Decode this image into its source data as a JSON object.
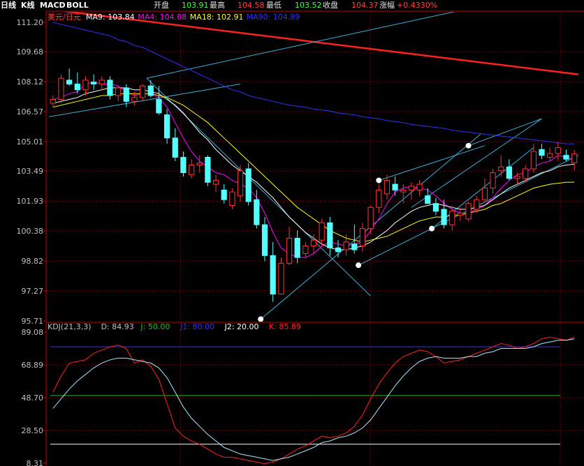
{
  "header": {
    "tabs": [
      {
        "label": "日线",
        "color": "#ffffff"
      },
      {
        "label": "K线",
        "color": "#ffffff"
      },
      {
        "label": "MACD",
        "color": "#ffffff"
      },
      {
        "label": "BOLL",
        "color": "#ffffff"
      }
    ],
    "quote": [
      {
        "label": "开盘",
        "value": "103.91"
      },
      {
        "label": "最高",
        "value": "104.58"
      },
      {
        "label": "最低",
        "value": "103.52"
      },
      {
        "label": "收盘",
        "value": "104.37"
      },
      {
        "label": "涨幅",
        "value": "+0.4330%"
      }
    ]
  },
  "chart_data": [
    {
      "type": "candlestick",
      "symbol": "美元/日元",
      "legend": [
        {
          "text": "MA9: 103.84",
          "color": "#ffffff"
        },
        {
          "text": "MA4: 104.08",
          "color": "#ff00ff"
        },
        {
          "text": "MA18: 102.91",
          "color": "#ffff00"
        },
        {
          "text": "MA90: 104.89",
          "color": "#3030ff"
        }
      ],
      "y_ticks": [
        "111.20",
        "109.68",
        "108.12",
        "106.57",
        "105.01",
        "103.49",
        "101.93",
        "100.38",
        "98.82",
        "97.27",
        "95.71"
      ],
      "ylim": [
        95.71,
        111.2
      ],
      "candles": [
        [
          107.0,
          107.4,
          106.8,
          107.2
        ],
        [
          107.2,
          108.5,
          107.0,
          108.3
        ],
        [
          108.2,
          108.8,
          107.9,
          108.0
        ],
        [
          108.0,
          108.6,
          107.5,
          107.7
        ],
        [
          107.7,
          108.4,
          107.4,
          108.2
        ],
        [
          108.1,
          108.5,
          107.7,
          108.0
        ],
        [
          108.0,
          108.4,
          107.7,
          108.2
        ],
        [
          108.2,
          108.4,
          107.2,
          107.4
        ],
        [
          107.4,
          107.9,
          107.1,
          107.8
        ],
        [
          107.8,
          108.0,
          106.8,
          107.1
        ],
        [
          107.1,
          107.6,
          106.9,
          107.3
        ],
        [
          107.3,
          108.0,
          107.1,
          107.9
        ],
        [
          107.9,
          108.2,
          107.3,
          107.4
        ],
        [
          107.2,
          107.9,
          106.4,
          106.5
        ],
        [
          106.4,
          106.7,
          104.9,
          105.2
        ],
        [
          105.2,
          105.7,
          104.0,
          104.2
        ],
        [
          104.2,
          104.5,
          103.2,
          103.4
        ],
        [
          103.3,
          104.1,
          103.1,
          103.8
        ],
        [
          103.8,
          104.3,
          103.4,
          103.9
        ],
        [
          104.2,
          104.3,
          102.7,
          102.9
        ],
        [
          102.8,
          103.3,
          102.4,
          103.0
        ],
        [
          102.5,
          102.8,
          101.8,
          102.0
        ],
        [
          101.7,
          102.6,
          101.5,
          102.4
        ],
        [
          102.2,
          103.8,
          101.9,
          103.5
        ],
        [
          103.6,
          103.9,
          101.7,
          101.9
        ],
        [
          102.0,
          102.5,
          100.5,
          100.7
        ],
        [
          100.7,
          101.1,
          98.8,
          99.1
        ],
        [
          99.1,
          99.8,
          96.7,
          97.1
        ],
        [
          97.1,
          99.0,
          97.1,
          98.7
        ],
        [
          98.7,
          100.6,
          98.6,
          100.0
        ],
        [
          100.0,
          100.4,
          98.7,
          99.0
        ],
        [
          99.2,
          99.8,
          99.0,
          99.6
        ],
        [
          99.6,
          100.2,
          99.2,
          99.9
        ],
        [
          99.9,
          101.0,
          99.6,
          100.8
        ],
        [
          100.8,
          101.1,
          99.1,
          99.5
        ],
        [
          99.5,
          99.9,
          99.0,
          99.3
        ],
        [
          99.4,
          100.2,
          99.1,
          99.8
        ],
        [
          99.7,
          100.7,
          99.2,
          99.4
        ],
        [
          99.6,
          100.8,
          99.3,
          100.5
        ],
        [
          100.5,
          101.7,
          100.2,
          101.6
        ],
        [
          101.6,
          102.8,
          101.3,
          102.5
        ],
        [
          102.3,
          103.3,
          102.0,
          103.0
        ],
        [
          102.8,
          103.2,
          102.2,
          102.5
        ],
        [
          102.4,
          102.8,
          101.8,
          102.5
        ],
        [
          102.5,
          102.9,
          102.0,
          102.7
        ],
        [
          102.5,
          103.0,
          102.2,
          102.8
        ],
        [
          102.2,
          102.6,
          101.8,
          101.8
        ],
        [
          101.8,
          102.1,
          101.2,
          101.4
        ],
        [
          101.5,
          102.0,
          100.5,
          100.7
        ],
        [
          100.7,
          101.7,
          100.4,
          101.4
        ],
        [
          101.2,
          101.6,
          100.9,
          101.3
        ],
        [
          101.0,
          101.9,
          100.9,
          101.8
        ],
        [
          101.5,
          102.2,
          101.3,
          102.0
        ],
        [
          102.0,
          103.1,
          101.9,
          102.6
        ],
        [
          102.6,
          103.6,
          102.3,
          103.4
        ],
        [
          103.5,
          104.3,
          103.2,
          103.7
        ],
        [
          103.7,
          104.1,
          103.0,
          103.1
        ],
        [
          103.1,
          103.4,
          102.8,
          103.2
        ],
        [
          103.1,
          103.8,
          102.9,
          103.6
        ],
        [
          103.6,
          104.9,
          103.4,
          104.5
        ],
        [
          104.6,
          104.9,
          104.1,
          104.3
        ],
        [
          104.2,
          104.7,
          104.0,
          104.4
        ],
        [
          104.4,
          105.0,
          104.0,
          104.7
        ],
        [
          104.3,
          104.6,
          104.0,
          104.1
        ],
        [
          103.91,
          104.58,
          103.52,
          104.37
        ]
      ],
      "ma": [
        {
          "name": "MA4",
          "color": "#ff00ff",
          "values": [
            107.2,
            107.3,
            107.5,
            107.6,
            108.0,
            108.1,
            108.0,
            108.0,
            107.9,
            107.6,
            107.4,
            107.5,
            107.5,
            107.3,
            106.8,
            106.0,
            105.2,
            104.5,
            104.0,
            103.7,
            103.4,
            103.3,
            103.0,
            102.8,
            102.6,
            102.1,
            101.3,
            100.3,
            99.5,
            99.2,
            99.0,
            99.0,
            99.2,
            99.6,
            99.8,
            99.7,
            99.6,
            99.7,
            99.8,
            100.4,
            101.0,
            101.8,
            102.4,
            102.6,
            102.7,
            102.6,
            102.5,
            102.2,
            101.8,
            101.5,
            101.3,
            101.3,
            101.5,
            101.7,
            102.1,
            102.6,
            103.0,
            103.3,
            103.4,
            103.7,
            103.9,
            104.0,
            104.3,
            104.2,
            104.08
          ]
        },
        {
          "name": "MA9",
          "color": "#ffffff",
          "values": [
            107.0,
            107.1,
            107.2,
            107.3,
            107.5,
            107.6,
            107.7,
            107.8,
            107.8,
            107.8,
            107.7,
            107.7,
            107.6,
            107.5,
            107.2,
            106.9,
            106.5,
            106.0,
            105.5,
            105.1,
            104.6,
            104.2,
            103.8,
            103.5,
            103.2,
            102.9,
            102.5,
            102.1,
            101.6,
            101.1,
            100.7,
            100.3,
            100.0,
            99.7,
            99.5,
            99.4,
            99.4,
            99.5,
            99.6,
            99.8,
            100.1,
            100.4,
            100.8,
            101.1,
            101.4,
            101.6,
            101.7,
            101.8,
            101.7,
            101.6,
            101.5,
            101.5,
            101.6,
            101.7,
            102.0,
            102.3,
            102.6,
            102.8,
            103.0,
            103.2,
            103.4,
            103.5,
            103.7,
            103.8,
            103.84
          ]
        },
        {
          "name": "MA18",
          "color": "#ffff00",
          "values": [
            106.8,
            106.9,
            107.0,
            107.1,
            107.2,
            107.3,
            107.4,
            107.4,
            107.5,
            107.5,
            107.5,
            107.5,
            107.5,
            107.4,
            107.3,
            107.1,
            106.9,
            106.6,
            106.3,
            106.0,
            105.6,
            105.2,
            104.8,
            104.4,
            104.0,
            103.6,
            103.2,
            102.8,
            102.4,
            102.0,
            101.6,
            101.3,
            101.0,
            100.7,
            100.4,
            100.2,
            100.0,
            99.9,
            99.8,
            99.9,
            100.0,
            100.1,
            100.3,
            100.5,
            100.7,
            100.9,
            101.0,
            101.1,
            101.1,
            101.2,
            101.2,
            101.3,
            101.4,
            101.5,
            101.7,
            101.8,
            102.0,
            102.2,
            102.4,
            102.6,
            102.7,
            102.8,
            102.85,
            102.9,
            102.91
          ]
        },
        {
          "name": "MA90",
          "color": "#3030ff",
          "values": [
            111.2,
            111.1,
            111.0,
            110.9,
            110.8,
            110.7,
            110.6,
            110.5,
            110.3,
            110.2,
            110.0,
            109.9,
            109.7,
            109.5,
            109.3,
            109.1,
            108.9,
            108.7,
            108.5,
            108.3,
            108.1,
            107.9,
            107.7,
            107.6,
            107.4,
            107.3,
            107.2,
            107.1,
            107.0,
            106.9,
            106.85,
            106.8,
            106.7,
            106.65,
            106.6,
            106.5,
            106.45,
            106.4,
            106.3,
            106.25,
            106.2,
            106.1,
            106.05,
            106.0,
            105.9,
            105.85,
            105.8,
            105.75,
            105.7,
            105.6,
            105.55,
            105.5,
            105.45,
            105.4,
            105.35,
            105.3,
            105.25,
            105.2,
            105.15,
            105.1,
            105.05,
            105.0,
            104.95,
            104.9,
            104.89
          ]
        }
      ],
      "annotations": [
        {
          "type": "line",
          "color": "#ff2020",
          "x1": -1,
          "y1": 111.9,
          "x2": 64.5,
          "y2": 108.5
        },
        {
          "type": "line",
          "color": "#3ab0d8",
          "x1": -0.5,
          "y1": 106.3,
          "x2": 23,
          "y2": 108.0
        },
        {
          "type": "line",
          "color": "#3ab0d8",
          "x1": 11.5,
          "y1": 108.3,
          "x2": 39,
          "y2": 97.0
        },
        {
          "type": "line",
          "color": "#3ab0d8",
          "x1": 11.5,
          "y1": 108.3,
          "x2": 52,
          "y2": 112.0
        },
        {
          "type": "line",
          "color": "#3ab0d8",
          "x1": 25.5,
          "y1": 95.8,
          "x2": 52.5,
          "y2": 105.4
        },
        {
          "type": "line",
          "color": "#3ab0d8",
          "x1": 37.5,
          "y1": 98.6,
          "x2": 64.5,
          "y2": 104.3
        },
        {
          "type": "line",
          "color": "#3ab0d8",
          "x1": 40,
          "y1": 103.0,
          "x2": 53,
          "y2": 104.8
        },
        {
          "type": "line",
          "color": "#3ab0d8",
          "x1": 44,
          "y1": 101.6,
          "x2": 60,
          "y2": 106.2
        },
        {
          "type": "line",
          "color": "#3ab0d8",
          "x1": 51,
          "y1": 104.8,
          "x2": 60,
          "y2": 106.2
        },
        {
          "type": "line",
          "color": "#3ab0d8",
          "x1": 46.5,
          "y1": 100.5,
          "x2": 59,
          "y2": 104.7
        },
        {
          "type": "dot",
          "x": 25.5,
          "y": 95.8
        },
        {
          "type": "dot",
          "x": 37.5,
          "y": 98.6
        },
        {
          "type": "dot",
          "x": 40,
          "y": 103.0
        },
        {
          "type": "dot",
          "x": 46.5,
          "y": 100.5
        },
        {
          "type": "dot",
          "x": 51,
          "y": 104.8
        }
      ]
    },
    {
      "type": "line",
      "legend": [
        {
          "text": "KDJ(21,3,3)",
          "color": "#c0c0c0"
        },
        {
          "text": "D: 84.93",
          "color": "#c0c0c0"
        },
        {
          "text": "J: 50.00",
          "color": "#20c020"
        },
        {
          "text": "J1: 80.00",
          "color": "#3030ff"
        },
        {
          "text": "J2: 20.00",
          "color": "#ffffff"
        },
        {
          "text": "K: 85.89",
          "color": "#ff2020"
        }
      ],
      "y_ticks": [
        "89.08",
        "68.89",
        "48.70",
        "28.50",
        "8.31"
      ],
      "ylim": [
        8.31,
        89.08
      ],
      "hlines": [
        {
          "y": 80,
          "color": "#3030ff"
        },
        {
          "y": 50,
          "color": "#20c020"
        },
        {
          "y": 20,
          "color": "#ffffff"
        }
      ],
      "series": [
        {
          "name": "K",
          "color": "#ff2020",
          "values": [
            52,
            62,
            70,
            71,
            72,
            76,
            78,
            80,
            81,
            79,
            70,
            72,
            68,
            60,
            45,
            30,
            25,
            22,
            20,
            17,
            14,
            12,
            12,
            11,
            10,
            9,
            8,
            9,
            11,
            14,
            17,
            19,
            22,
            25,
            24,
            25,
            27,
            31,
            38,
            48,
            57,
            64,
            70,
            74,
            76,
            78,
            77,
            74,
            70,
            71,
            72,
            74,
            76,
            78,
            80,
            82,
            81,
            79,
            80,
            82,
            85,
            86,
            85,
            84,
            85.89
          ]
        },
        {
          "name": "D",
          "color": "#a8e8ff",
          "values": [
            42,
            48,
            54,
            59,
            63,
            67,
            70,
            72,
            73,
            73,
            72,
            71,
            70,
            67,
            61,
            52,
            43,
            36,
            31,
            26,
            22,
            18,
            16,
            14,
            13,
            12,
            11,
            10,
            11,
            12,
            14,
            16,
            18,
            21,
            22,
            24,
            25,
            27,
            30,
            35,
            42,
            49,
            56,
            62,
            67,
            71,
            73,
            74,
            73,
            73,
            73,
            74,
            74,
            76,
            77,
            79,
            79,
            79,
            79,
            80,
            82,
            83,
            84,
            84,
            84.93
          ]
        }
      ]
    }
  ]
}
